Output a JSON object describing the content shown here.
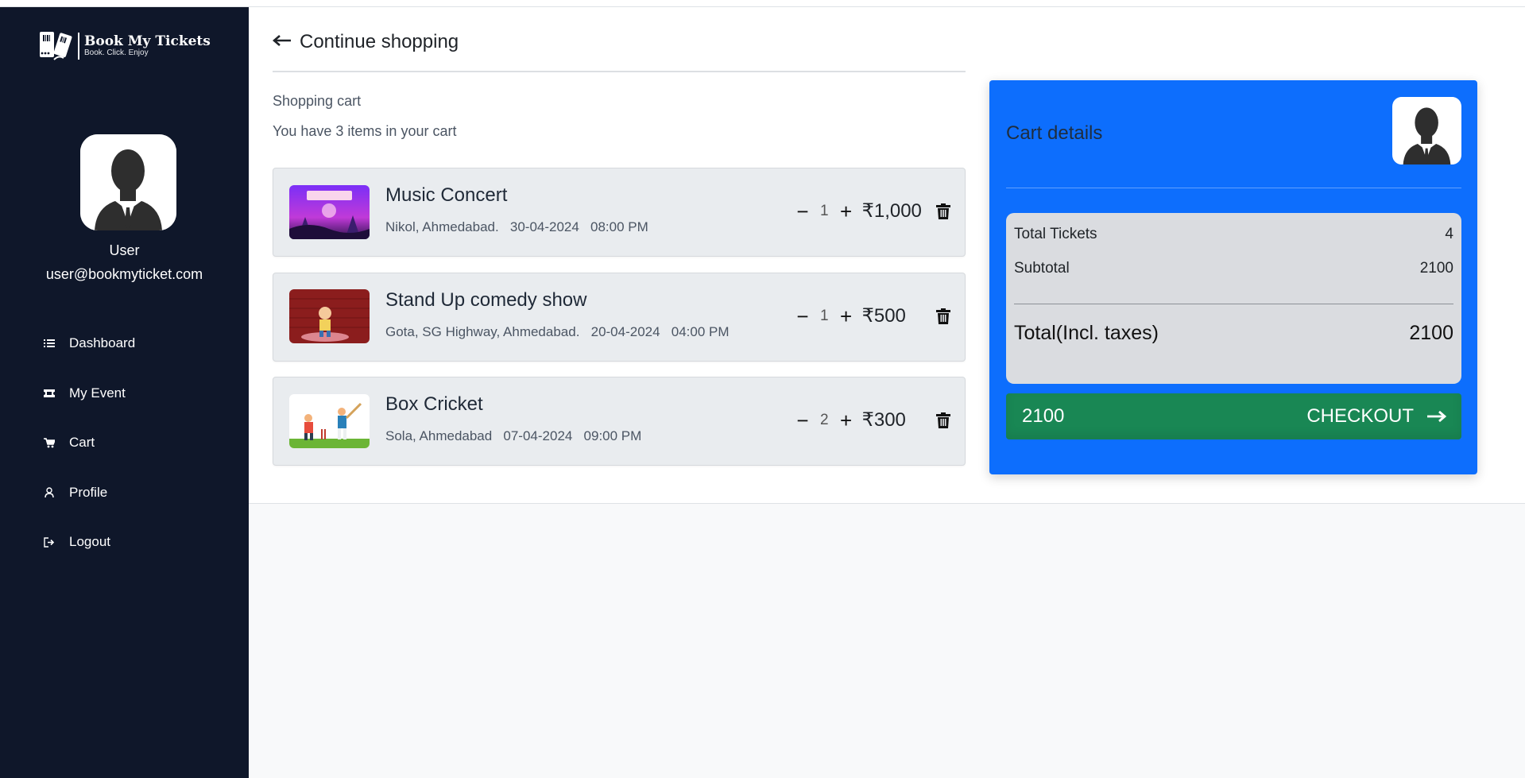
{
  "brand": {
    "name": "Book My Tickets",
    "tagline": "Book. Click. Enjoy"
  },
  "user": {
    "name": "User",
    "email": "user@bookmyticket.com"
  },
  "sidebar": {
    "items": [
      {
        "label": "Dashboard",
        "icon": "list-icon"
      },
      {
        "label": "My Event",
        "icon": "ticket-icon"
      },
      {
        "label": "Cart",
        "icon": "cart-icon"
      },
      {
        "label": "Profile",
        "icon": "user-icon"
      },
      {
        "label": "Logout",
        "icon": "logout-icon"
      }
    ]
  },
  "header": {
    "continue_label": "Continue shopping"
  },
  "cart": {
    "title": "Shopping cart",
    "subtitle": "You have 3 items in your cart",
    "items": [
      {
        "name": "Music Concert",
        "location": "Nikol, Ahmedabad.",
        "date": "30-04-2024",
        "time": "08:00 PM",
        "qty": "1",
        "price": "₹1,000"
      },
      {
        "name": "Stand Up comedy show",
        "location": "Gota, SG Highway, Ahmedabad.",
        "date": "20-04-2024",
        "time": "04:00 PM",
        "qty": "1",
        "price": "₹500"
      },
      {
        "name": "Box Cricket",
        "location": "Sola, Ahmedabad",
        "date": "07-04-2024",
        "time": "09:00 PM",
        "qty": "2",
        "price": "₹300"
      }
    ],
    "minus_label": "−",
    "plus_label": "+"
  },
  "details": {
    "title": "Cart details",
    "total_tickets_label": "Total Tickets",
    "total_tickets": "4",
    "subtotal_label": "Subtotal",
    "subtotal": "2100",
    "total_label": "Total(Incl. taxes)",
    "total": "2100",
    "checkout_amount": "2100",
    "checkout_label": "CHECKOUT"
  },
  "colors": {
    "sidebar": "#0f172a",
    "accent": "#0d6efd",
    "checkout": "#198754"
  }
}
